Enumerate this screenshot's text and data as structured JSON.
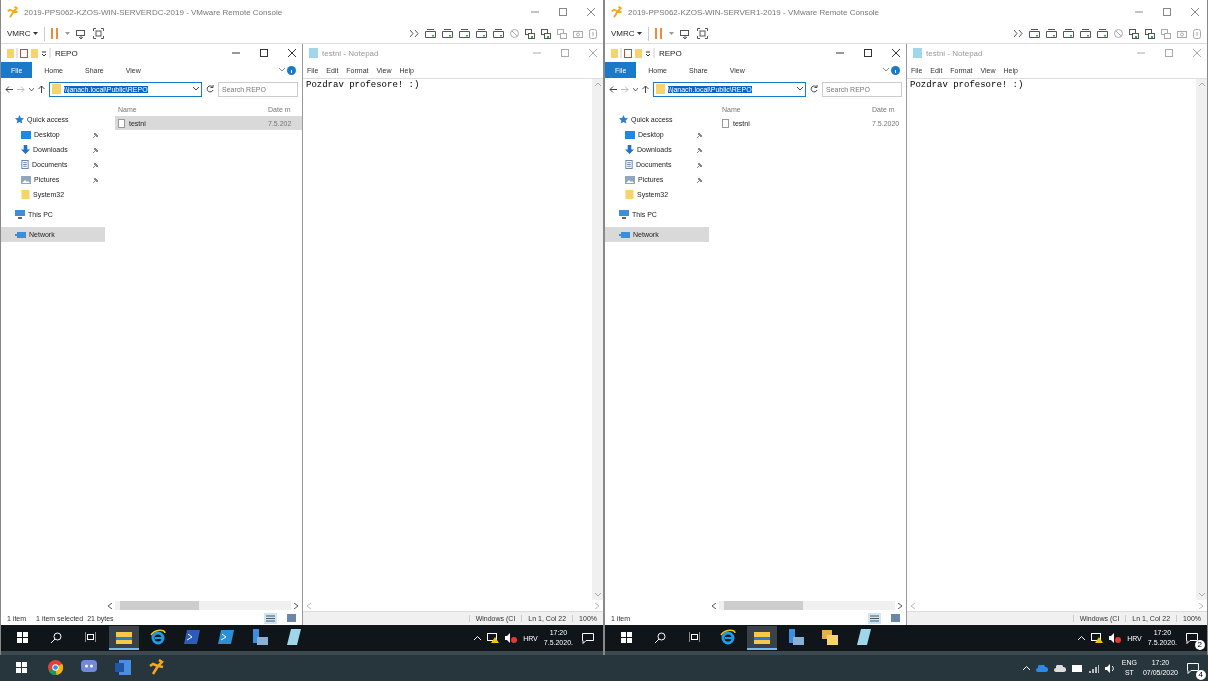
{
  "consoles": [
    {
      "title": "2019-PPS062-KZOS-WIN-SERVERDC-2019 - VMware Remote Console",
      "menu": "VMRC",
      "explorer": {
        "title": "REPO",
        "tabs": [
          {
            "label": "File",
            "selected": true
          },
          {
            "label": "Home",
            "selected": false
          },
          {
            "label": "Share",
            "selected": false
          },
          {
            "label": "View",
            "selected": false
          }
        ],
        "address": "\\\\janach.local\\Public\\REPO",
        "search": {
          "placeholder": "Search REPO"
        },
        "columns": [
          "Name",
          "Date m"
        ],
        "nav": [
          {
            "label": "Quick access",
            "kind": "star",
            "selected": false,
            "children": [
              {
                "label": "Desktop",
                "kind": "desktop",
                "pinned": true,
                "selected": false
              },
              {
                "label": "Downloads",
                "kind": "downloads",
                "pinned": true,
                "selected": false
              },
              {
                "label": "Documents",
                "kind": "documents",
                "pinned": true,
                "selected": false
              },
              {
                "label": "Pictures",
                "kind": "pictures",
                "pinned": true,
                "selected": false
              },
              {
                "label": "System32",
                "kind": "folder",
                "pinned": false,
                "selected": false
              }
            ]
          },
          {
            "label": "This PC",
            "kind": "pc",
            "selected": false
          },
          {
            "label": "Network",
            "kind": "network",
            "selected": true
          }
        ],
        "files": [
          {
            "name": "testni",
            "date": "7.5.202",
            "selected": true
          }
        ],
        "status": [
          "1 item",
          "1 item selected",
          "21 bytes"
        ]
      },
      "notepad": {
        "title": "testni - Notepad",
        "menu": [
          "File",
          "Edit",
          "Format",
          "View",
          "Help"
        ],
        "text": "Pozdrav profesore! :)",
        "status": [
          "Windows (CI",
          "Ln 1, Col 22",
          "100%"
        ]
      },
      "taskbar": {
        "apps": [
          {
            "kind": "explorer",
            "active": true
          },
          {
            "kind": "ie",
            "active": false
          },
          {
            "kind": "powershell",
            "active": false
          },
          {
            "kind": "ise",
            "active": false
          },
          {
            "kind": "server",
            "active": false
          },
          {
            "kind": "notepad",
            "active": false
          }
        ],
        "lang": "HRV",
        "time": "17:20",
        "date": "7.5.2020."
      }
    },
    {
      "title": "2019-PPS062-KZOS-WIN-SERVER1-2019 - VMware Remote Console",
      "menu": "VMRC",
      "explorer": {
        "title": "REPO",
        "tabs": [
          {
            "label": "File",
            "selected": true
          },
          {
            "label": "Home",
            "selected": false
          },
          {
            "label": "Share",
            "selected": false
          },
          {
            "label": "View",
            "selected": false
          }
        ],
        "address": "\\\\janach.local\\Public\\REPO",
        "search": {
          "placeholder": "Search REPO"
        },
        "columns": [
          "Name",
          "Date m"
        ],
        "nav": [
          {
            "label": "Quick access",
            "kind": "star",
            "selected": false,
            "children": [
              {
                "label": "Desktop",
                "kind": "desktop",
                "pinned": true,
                "selected": false
              },
              {
                "label": "Downloads",
                "kind": "downloads",
                "pinned": true,
                "selected": false
              },
              {
                "label": "Documents",
                "kind": "documents",
                "pinned": true,
                "selected": false
              },
              {
                "label": "Pictures",
                "kind": "pictures",
                "pinned": true,
                "selected": false
              },
              {
                "label": "System32",
                "kind": "folder",
                "pinned": false,
                "selected": false
              }
            ]
          },
          {
            "label": "This PC",
            "kind": "pc",
            "selected": false
          },
          {
            "label": "Network",
            "kind": "network",
            "selected": true
          }
        ],
        "files": [
          {
            "name": "testni",
            "date": "7.5.2020",
            "selected": false
          }
        ],
        "status": [
          "1 item"
        ]
      },
      "notepad": {
        "title": "testni - Notepad",
        "menu": [
          "File",
          "Edit",
          "Format",
          "View",
          "Help"
        ],
        "text": "Pozdrav profesore! :)",
        "status": [
          "Windows (CI",
          "Ln 1, Col 22",
          "100%"
        ]
      },
      "taskbar": {
        "apps": [
          {
            "kind": "ie",
            "active": false
          },
          {
            "kind": "explorer",
            "active": true
          },
          {
            "kind": "server",
            "active": false
          },
          {
            "kind": "folders",
            "active": false
          },
          {
            "kind": "notepad",
            "active": false
          }
        ],
        "lang": "HRV",
        "time": "17:20",
        "date": "7.5.2020.",
        "notifications": "2"
      }
    }
  ],
  "host_taskbar": {
    "apps": [
      {
        "kind": "chrome"
      },
      {
        "kind": "chat"
      },
      {
        "kind": "word"
      },
      {
        "kind": "vmware"
      }
    ],
    "lang": "ENG",
    "layout": "ST",
    "time": "17:20",
    "date": "07/05/2020",
    "notifications": "4"
  }
}
